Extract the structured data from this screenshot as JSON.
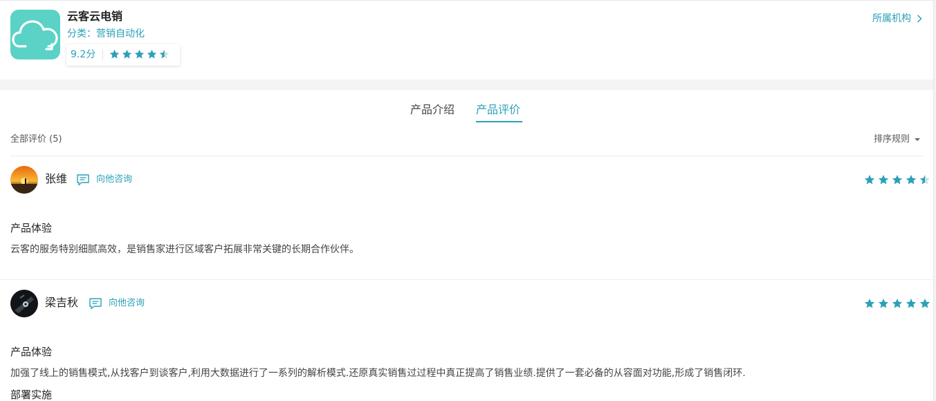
{
  "app": {
    "name": "云客云电销",
    "category": "分类：营销自动化",
    "score": "9.2分",
    "rating_stars": 4.5,
    "org_link": "所属机构",
    "logo_icon": "cloud-icon",
    "accent_color": "#2aa1b9",
    "logo_color": "#5bd2c6"
  },
  "tabs": [
    {
      "label": "产品介绍",
      "active": false
    },
    {
      "label": "产品评价",
      "active": true
    }
  ],
  "reviews_header": {
    "all_reviews": "全部评价 (5)",
    "sort_label": "排序规则"
  },
  "reviews": [
    {
      "name": "张维",
      "consult_label": "向他咨询",
      "stars": 4.5,
      "sections": [
        {
          "title": "产品体验",
          "text": "云客的服务特别细腻高效，是销售家进行区域客户拓展非常关键的长期合作伙伴。"
        }
      ]
    },
    {
      "name": "梁吉秋",
      "consult_label": "向他咨询",
      "stars": 5,
      "sections": [
        {
          "title": "产品体验",
          "text": "加强了线上的销售模式,从找客户到谈客户,利用大数据进行了一系列的解析模式.还原真实销售过过程中真正提高了销售业绩.提供了一套必备的从容面对功能,形成了销售闭环."
        },
        {
          "title": "部署实施",
          "text": ""
        }
      ]
    }
  ]
}
